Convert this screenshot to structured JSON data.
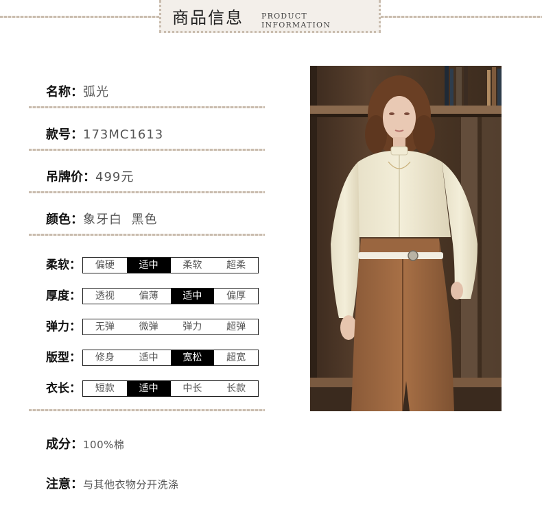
{
  "header": {
    "title_cn": "商品信息",
    "title_en": "PRODUCT INFORMATION"
  },
  "info": {
    "name": {
      "label": "名称：",
      "value": "弧光"
    },
    "style": {
      "label": "款号：",
      "value": "173MC1613"
    },
    "price": {
      "label": "吊牌价：",
      "value": "499元"
    },
    "color": {
      "label": "颜色：",
      "value": "象牙白  黑色"
    }
  },
  "attributes": [
    {
      "label": "柔软：",
      "options": [
        "偏硬",
        "适中",
        "柔软",
        "超柔"
      ],
      "selected": 1
    },
    {
      "label": "厚度：",
      "options": [
        "透视",
        "偏薄",
        "适中",
        "偏厚"
      ],
      "selected": 2
    },
    {
      "label": "弹力：",
      "options": [
        "无弹",
        "微弹",
        "弹力",
        "超弹"
      ],
      "selected": -1
    },
    {
      "label": "版型：",
      "options": [
        "修身",
        "适中",
        "宽松",
        "超宽"
      ],
      "selected": 2
    },
    {
      "label": "衣长：",
      "options": [
        "短款",
        "适中",
        "中长",
        "长款"
      ],
      "selected": 1
    }
  ],
  "composition": {
    "label": "成分：",
    "value": "100%棉"
  },
  "notice": {
    "label": "注意：",
    "value": "与其他衣物分开洗涤"
  },
  "colors": {
    "selected_bg": "#000000",
    "dotted_line": "#c9bcae",
    "header_bg": "#f3efea"
  }
}
